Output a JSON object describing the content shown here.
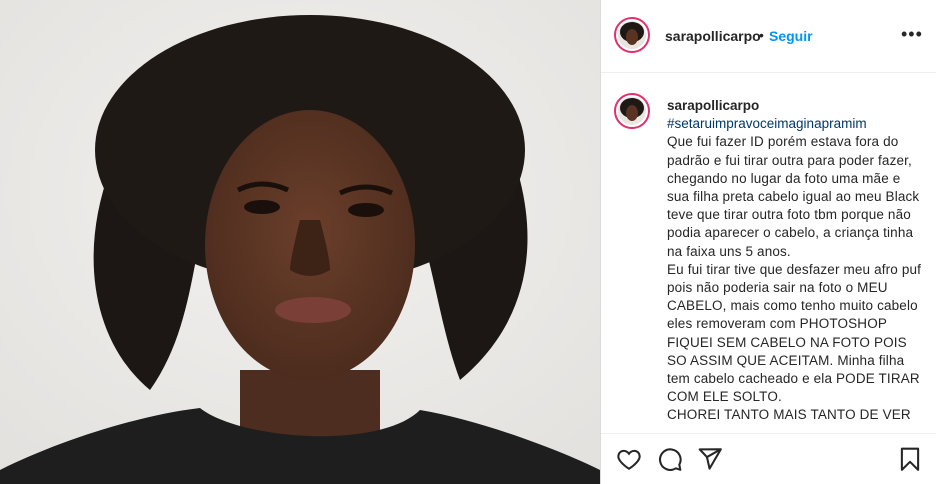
{
  "post": {
    "username": "sarapollicarpo",
    "dot": "•",
    "follow_label": "Seguir",
    "more_label": "•••",
    "caption": {
      "username": "sarapollicarpo",
      "hashtag": "#setaruimpravoceimaginapramim",
      "body": "Que fui fazer ID porém estava fora do padrão e fui tirar outra para poder fazer, chegando no lugar da foto uma mãe e sua filha preta cabelo igual ao meu Black teve que tirar outra foto tbm porque não podia aparecer o cabelo, a criança tinha na faixa uns 5 anos.\nEu fui tirar tive que desfazer meu afro puf pois não poderia sair na foto o MEU CABELO, mais como tenho muito cabelo eles removeram com PHOTOSHOP FIQUEI SEM CABELO NA FOTO POIS SO ASSIM QUE ACEITAM. Minha filha tem cabelo cacheado e ela PODE TIRAR COM ELE SOLTO.\nCHOREI TANTO MAIS TANTO DE VER"
    },
    "actions": {
      "like_icon": "heart-icon",
      "comment_icon": "comment-icon",
      "share_icon": "paper-plane-icon",
      "save_icon": "bookmark-icon"
    }
  },
  "colors": {
    "follow": "#0095f6",
    "hashtag": "#00376b",
    "text": "#262626",
    "avatar_ring": "#e1306c"
  }
}
